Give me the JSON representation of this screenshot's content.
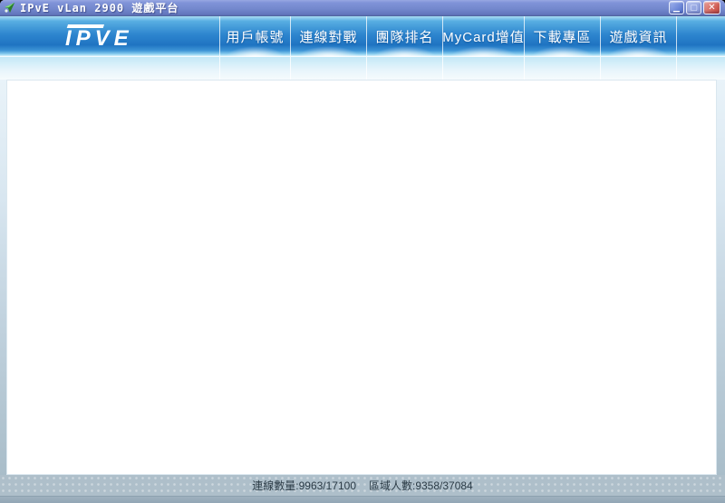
{
  "window": {
    "title": "IPvE vLan 2900 遊戲平台",
    "controls": {
      "minimize_glyph": "▁",
      "maximize_glyph": "▢",
      "close_glyph": "✕"
    }
  },
  "header": {
    "logo": "IPVE"
  },
  "nav": {
    "items": [
      {
        "label": "用戶帳號"
      },
      {
        "label": "連線對戰"
      },
      {
        "label": "團隊排名"
      },
      {
        "label": "MyCard增值"
      },
      {
        "label": "下載專區"
      },
      {
        "label": "遊戲資訊"
      }
    ]
  },
  "status_bar": {
    "connections": "連線數量:9963/17100",
    "region": "區域人數:9358/37084"
  },
  "colors": {
    "titlebar_blue": "#7489ce",
    "nav_blue": "#2377c6",
    "status_gray": "#aebfca",
    "close_red": "#cf5a50",
    "app_icon_green": "#3aa53c"
  }
}
